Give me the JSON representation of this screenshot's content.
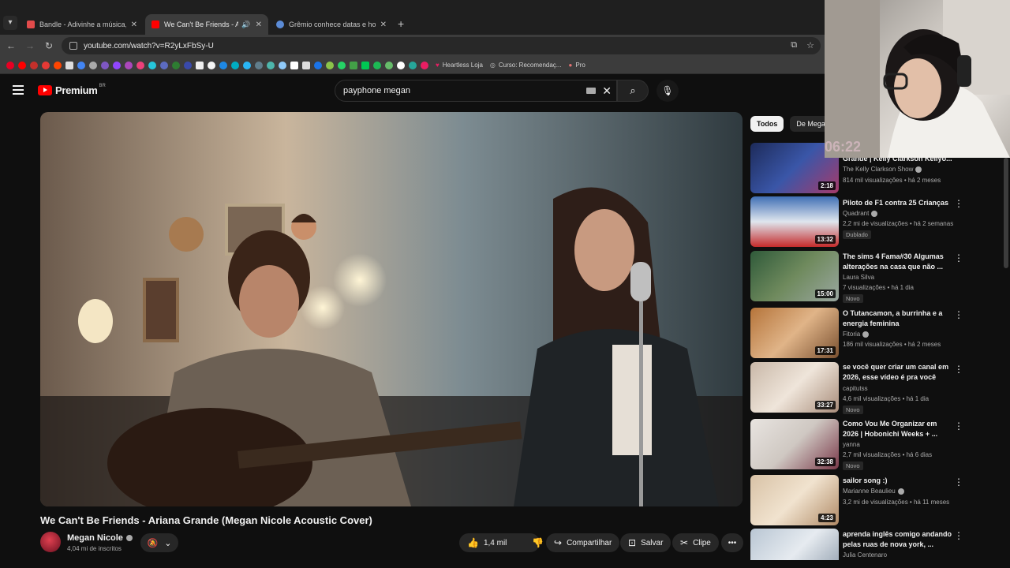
{
  "browser": {
    "tabs": [
      {
        "title": "Bandle - Adivinhe a música, um",
        "active": false,
        "favicon_color": "#e24b4b"
      },
      {
        "title": "We Can't Be Friends - Arian",
        "active": true,
        "favicon_color": "#ff0000",
        "audio": "🔊"
      },
      {
        "title": "Grêmio conhece datas e horár",
        "active": false,
        "favicon_color": "#5b8bd6"
      }
    ],
    "tab_close": "✕",
    "new_tab": "+",
    "url": "youtube.com/watch?v=R2yLxFbSy-U",
    "bookmarks_text": [
      "Heartless Loja",
      "Curso: Recomendaç...",
      "Pro"
    ]
  },
  "header": {
    "logo_text": "Premium",
    "logo_region": "BR",
    "search_value": "payphone megan",
    "search_clear": "✕",
    "search_icon": "⌕",
    "mic_icon": "🎙"
  },
  "video": {
    "title": "We Can't Be Friends - Ariana Grande (Megan Nicole Acoustic Cover)",
    "channel": "Megan Nicole",
    "subscribers": "4,04 mi de inscritos",
    "likes": "1,4 mil",
    "share_label": "Compartilhar",
    "save_label": "Salvar",
    "clip_label": "Clipe",
    "more": "•••"
  },
  "sidebar": {
    "chips": [
      "Todos",
      "De Megan"
    ],
    "recommendations": [
      {
        "title": "Grande | Kelly Clarkson Kellyo...",
        "channel": "The Kelly Clarkson Show",
        "verified": true,
        "meta": "814 mil visualizações • há 2 meses",
        "duration": "2:18",
        "badge": "",
        "thumb": "linear-gradient(135deg,#1d2b5a,#3a56a8 50%,#a63a6a)"
      },
      {
        "title": "Piloto de F1 contra 25 Crianças",
        "channel": "Quadrant",
        "verified": true,
        "meta": "2,2 mi de visualizações • há 2 semanas",
        "duration": "13:32",
        "badge": "Dublado",
        "thumb": "linear-gradient(180deg,#3f6fb5,#dfe6ee 50%,#c42b2b)"
      },
      {
        "title": "The sims 4 Fama#30 Algumas alterações na casa que não ...",
        "channel": "Laura Silva",
        "verified": false,
        "meta": "7 visualizações • há 1 dia",
        "duration": "15:00",
        "badge": "Novo",
        "thumb": "linear-gradient(135deg,#2f5a3a,#6f8a5d 50%,#9aa7a0)"
      },
      {
        "title": "O Tutancamon, a burrinha e a energia feminina",
        "channel": "Fitoria",
        "verified": true,
        "meta": "186 mil visualizações • há 2 meses",
        "duration": "17:31",
        "badge": "",
        "thumb": "linear-gradient(135deg,#b5743a,#e0b488 50%,#7a5030)"
      },
      {
        "title": "se você quer criar um canal em 2026, esse vídeo é pra você",
        "channel": "capitutss",
        "verified": false,
        "meta": "4,6 mil visualizações • há 1 dia",
        "duration": "33:27",
        "badge": "Novo",
        "thumb": "linear-gradient(135deg,#c9b8a8,#efe5da 50%,#a88c7a)"
      },
      {
        "title": "Como Vou Me Organizar em 2026 | Hobonichi Weeks + ...",
        "channel": "yanna",
        "verified": false,
        "meta": "2,7 mil visualizações • há 6 dias",
        "duration": "32:38",
        "badge": "Novo",
        "thumb": "linear-gradient(135deg,#e8e4e0,#cfc8c2 50%,#7a3a4a)"
      },
      {
        "title": "sailor song :)",
        "channel": "Marianne Beaulieu",
        "verified": true,
        "meta": "3,2 mi de visualizações • há 11 meses",
        "duration": "4:23",
        "badge": "",
        "thumb": "linear-gradient(135deg,#d8c2a6,#f1e3cf 50%,#b08a66)"
      },
      {
        "title": "aprenda inglês comigo andando pelas ruas de nova york, ...",
        "channel": "Julia Centenaro",
        "verified": false,
        "meta": "",
        "duration": "",
        "badge": "",
        "thumb": "linear-gradient(135deg,#b9c6d3,#e6ebf0 50%,#8a98a8)"
      }
    ]
  },
  "overlay": {
    "timer": "06:22"
  },
  "colors": {
    "bg": "#0f0f0f",
    "accent": "#ff0000",
    "pill": "#272727"
  }
}
